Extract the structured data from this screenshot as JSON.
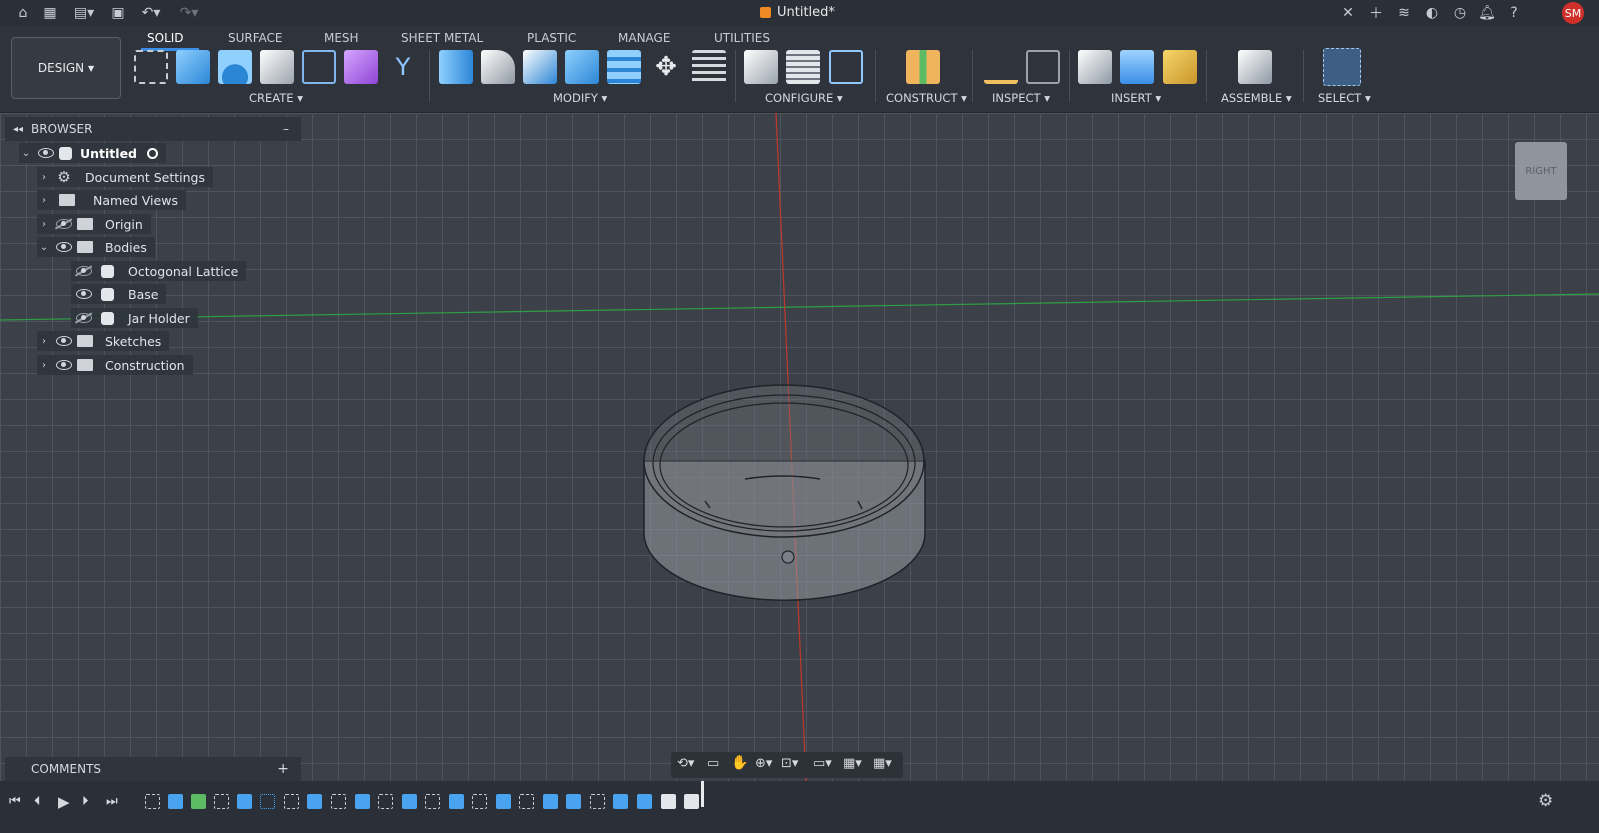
{
  "titlebar": {
    "document_title": "Untitled*",
    "avatar_initials": "SM"
  },
  "toolbar": {
    "workspace_label": "DESIGN",
    "tabs": [
      "SOLID",
      "SURFACE",
      "MESH",
      "SHEET METAL",
      "PLASTIC",
      "MANAGE",
      "UTILITIES"
    ],
    "active_tab": "SOLID",
    "groups": {
      "create": "CREATE",
      "modify": "MODIFY",
      "configure": "CONFIGURE",
      "construct": "CONSTRUCT",
      "inspect": "INSPECT",
      "insert": "INSERT",
      "assemble": "ASSEMBLE",
      "select": "SELECT"
    }
  },
  "browser": {
    "title": "BROWSER",
    "root": "Untitled",
    "items": [
      {
        "label": "Document Settings",
        "icon": "gear-icon",
        "visible": null
      },
      {
        "label": "Named Views",
        "icon": "folder-icon",
        "visible": null
      },
      {
        "label": "Origin",
        "icon": "folder-icon",
        "visible": false
      },
      {
        "label": "Bodies",
        "icon": "folder-icon",
        "visible": true,
        "expanded": true
      },
      {
        "label": "Octogonal Lattice",
        "icon": "body-icon",
        "visible": false
      },
      {
        "label": "Base",
        "icon": "body-icon",
        "visible": true
      },
      {
        "label": "Jar Holder",
        "icon": "body-icon",
        "visible": false
      },
      {
        "label": "Sketches",
        "icon": "folder-icon",
        "visible": true
      },
      {
        "label": "Construction",
        "icon": "folder-icon",
        "visible": true
      }
    ]
  },
  "comments": {
    "title": "COMMENTS"
  },
  "viewcube": {
    "face": "RIGHT"
  },
  "colors": {
    "accent": "#3a8ee6",
    "toolbar_bg": "#2f343c",
    "viewport_bg": "#3c4149",
    "x_axis": "#c0392b",
    "y_axis": "#2e9e44"
  }
}
